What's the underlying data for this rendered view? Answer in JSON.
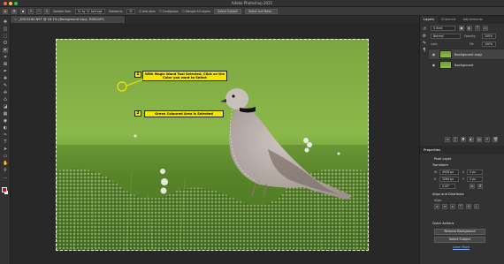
{
  "window": {
    "title": "Adobe Photoshop 2021",
    "buttons": {
      "close": "#ff5f57",
      "minimize": "#febc2e",
      "zoom": "#28c840"
    }
  },
  "options_bar": {
    "sample_size_label": "Sample Size:",
    "sample_size_value": "51 by 51 Average",
    "tolerance_label": "Tolerance:",
    "tolerance_value": "32",
    "anti_alias_label": "Anti-alias",
    "contiguous_label": "Contiguous",
    "sample_all_layers_label": "Sample All Layers",
    "select_subject_label": "Select Subject",
    "select_mask_label": "Select and Mask..."
  },
  "document_tab": {
    "close": "×",
    "label": "_DSC5180.NEF @ 16.7% (Background copy, RGB/16*)"
  },
  "toolbar": {
    "tools": [
      "move-icon",
      "artboard-icon",
      "marquee-icon",
      "lasso-icon",
      "magic-wand-icon",
      "crop-icon",
      "frame-icon",
      "eyedropper-icon",
      "healing-icon",
      "brush-icon",
      "clone-stamp-icon",
      "history-brush-icon",
      "eraser-icon",
      "gradient-icon",
      "blur-icon",
      "dodge-icon",
      "pen-icon",
      "type-icon",
      "path-select-icon",
      "shape-icon",
      "hand-icon",
      "zoom-icon",
      "more-icon"
    ],
    "glyphs": [
      "✥",
      "◫",
      "⬚",
      "ʘ",
      "✶",
      "⌗",
      "⊠",
      "✒",
      "✚",
      "✎",
      "✣",
      "♺",
      "◪",
      "▦",
      "◉",
      "◐",
      "✑",
      "T",
      "➤",
      "▭",
      "✋",
      "⚲",
      "…"
    ],
    "foreground_color": "#c0161b",
    "background_color": "#fafafa"
  },
  "annotations": {
    "step1_number": "1",
    "step1_text": "With Magic Wand Tool Selected, Click on the Color you want to Select",
    "step2_number": "2",
    "step2_text": "Green Coloured Area is Selected"
  },
  "layers_panel": {
    "tabs": [
      "Layers",
      "Channels",
      "Adjustments"
    ],
    "kind_label": "Kind",
    "blend_mode": "Normal",
    "opacity_label": "Opacity:",
    "opacity_value": "100%",
    "lock_label": "Lock:",
    "fill_label": "Fill:",
    "fill_value": "100%",
    "layers": [
      {
        "name": "Background copy",
        "selected": true
      },
      {
        "name": "Background",
        "selected": false
      }
    ]
  },
  "properties_panel": {
    "title": "Properties",
    "layer_type": "Pixel Layer",
    "transform_label": "Transform",
    "w_label": "W",
    "w_value": "4928 px",
    "h_label": "H",
    "h_value": "3264 px",
    "x_label": "X",
    "x_value": "0 px",
    "y_label": "Y",
    "y_value": "0 px",
    "angle_value": "0.00°",
    "align_label": "Align and Distribute",
    "align_sub": "Align:",
    "quick_actions_label": "Quick Actions",
    "remove_bg_label": "Remove Background",
    "select_subject_label": "Select Subject",
    "learn_more": "Learn More"
  }
}
